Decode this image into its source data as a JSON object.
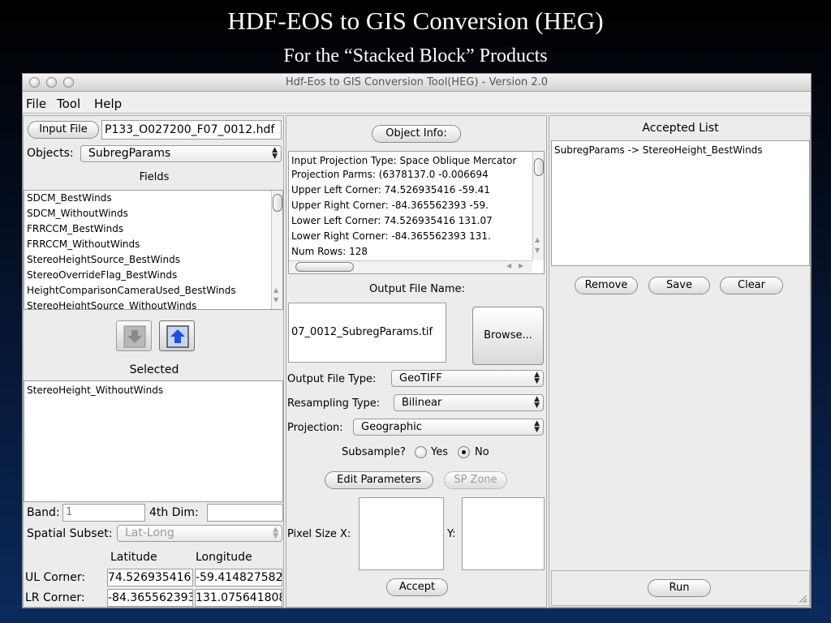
{
  "slide": {
    "title": "HDF-EOS to GIS Conversion (HEG)",
    "subtitle": "For the “Stacked Block” Products"
  },
  "window": {
    "title": "Hdf-Eos to GIS Conversion Tool(HEG) - Version 2.0"
  },
  "menu": [
    "File",
    "Tool",
    "Help"
  ],
  "left_panel": {
    "input_file_button": "Input File",
    "input_file_value": "P133_O027200_F07_0012.hdf",
    "objects_label": "Objects:",
    "objects_value": "SubregParams",
    "fields_heading": "Fields",
    "fields": [
      "SDCM_BestWinds",
      "SDCM_WithoutWinds",
      "FRRCCM_BestWinds",
      "FRRCCM_WithoutWinds",
      "StereoHeightSource_BestWinds",
      "StereoOverrideFlag_BestWinds",
      "HeightComparisonCameraUsed_BestWinds",
      "StereoHeightSource_WithoutWinds"
    ],
    "selected_heading": "Selected",
    "selected_items": [
      "StereoHeight_WithoutWinds"
    ],
    "band_label": "Band:",
    "band_value": "1",
    "dim4_label": "4th Dim:",
    "dim4_value": "",
    "spatial_subset_label": "Spatial Subset:",
    "spatial_subset_value": "Lat-Long",
    "latitude_header": "Latitude",
    "longitude_header": "Longitude",
    "ul_corner_label": "UL Corner:",
    "ul_lat": "74.526935416",
    "ul_lon": "-59.414827582",
    "lr_corner_label": "LR Corner:",
    "lr_lat": "-84.365562393",
    "lr_lon": "131.075641808"
  },
  "middle_panel": {
    "object_info_button": "Object Info:",
    "info_lines": [
      "Input Projection Type:  Space Oblique Mercator",
      "Projection Parms:  (6378137.0   -0.006694",
      "Upper Left Corner:  74.526935416    -59.41",
      "Upper Right Corner:  -84.365562393    -59.",
      "Lower Left Corner:  74.526935416    131.07",
      "Lower Right Corner:  -84.365562393    131.",
      "Num Rows:  128"
    ],
    "output_file_name_label": "Output File Name:",
    "output_file_name_value": "07_0012_SubregParams.tif",
    "browse_button": "Browse...",
    "output_file_type_label": "Output File Type:",
    "output_file_type_value": "GeoTIFF",
    "resampling_type_label": "Resampling Type:",
    "resampling_type_value": "Bilinear",
    "projection_label": "Projection:",
    "projection_value": "Geographic",
    "subsample_label": "Subsample?",
    "subsample_yes": "Yes",
    "subsample_no": "No",
    "subsample_selected": "No",
    "edit_parameters_button": "Edit Parameters",
    "sp_zone_button": "SP Zone",
    "pixel_size_x_label": "Pixel Size X:",
    "pixel_size_x_value": "",
    "pixel_size_y_label": "Y:",
    "pixel_size_y_value": "",
    "accept_button": "Accept"
  },
  "right_panel": {
    "accepted_list_heading": "Accepted List",
    "accepted_items": [
      "SubregParams -> StereoHeight_BestWinds"
    ],
    "remove_button": "Remove",
    "save_button": "Save",
    "clear_button": "Clear",
    "run_button": "Run"
  },
  "icons": {
    "down_arrow": "arrow-down-icon",
    "up_arrow": "arrow-up-icon"
  },
  "colors": {
    "up_arrow": "#1f4fe0",
    "down_arrow": "#9a9a9a"
  }
}
